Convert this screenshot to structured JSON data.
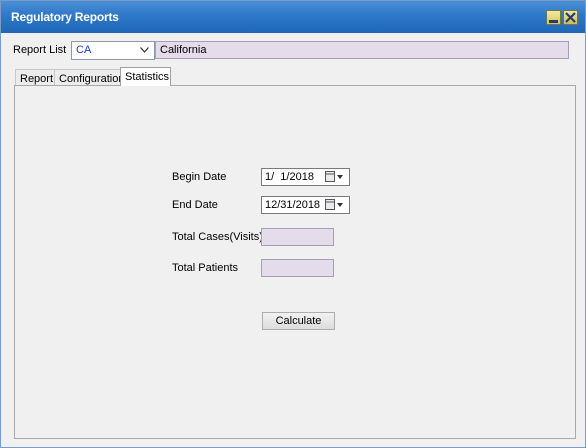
{
  "window": {
    "title": "Regulatory Reports"
  },
  "toolbar": {
    "report_list_label": "Report List",
    "report_list_value": "CA",
    "report_name_value": "California"
  },
  "tabs": [
    {
      "label": "Report"
    },
    {
      "label": "Configuration"
    },
    {
      "label": "Statistics",
      "active": true
    }
  ],
  "statistics": {
    "begin_date_label": "Begin Date",
    "begin_date_value": "1/  1/2018",
    "end_date_label": "End Date",
    "end_date_value": "12/31/2018",
    "total_cases_label": "Total Cases(Visits)",
    "total_cases_value": "",
    "total_patients_label": "Total Patients",
    "total_patients_value": "",
    "calculate_label": "Calculate"
  },
  "colors": {
    "titlebar": "#2e78c8",
    "readonly_field": "#e4dcea",
    "selected_code": "#1a3fd0"
  }
}
